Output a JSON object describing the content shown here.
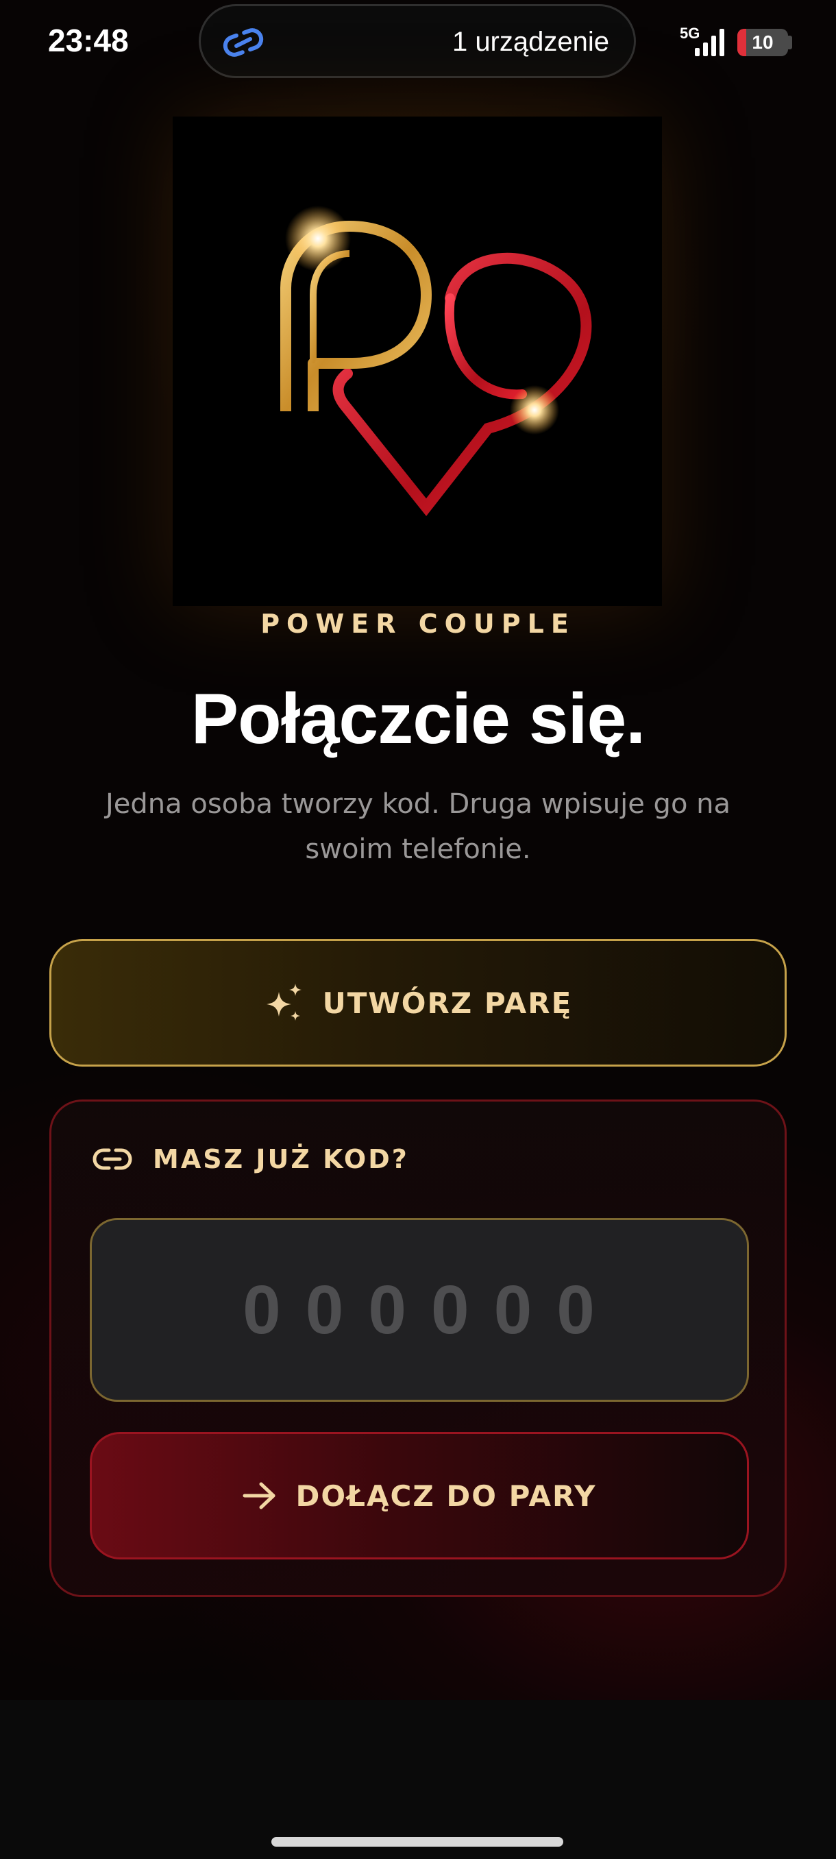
{
  "status_bar": {
    "time": "23:48",
    "island_text": "1 urządzenie",
    "network": "5G",
    "battery": "10",
    "battery_level_percent": 10
  },
  "brand": {
    "name": "POWER COUPLE"
  },
  "main": {
    "title": "Połączcie się.",
    "subtitle": "Jedna osoba tworzy kod. Druga wpisuje go na swoim telefonie."
  },
  "create_button": {
    "label": "UTWÓRZ PARĘ",
    "icon": "sparkles-icon"
  },
  "join_card": {
    "header_label": "MASZ JUŻ KOD?",
    "header_icon": "link-icon",
    "code_placeholder": "000000",
    "code_value": "",
    "join_label": "DOŁĄCZ DO PARY",
    "join_icon": "arrow-right-icon"
  },
  "colors": {
    "gold": "#f3d7a4",
    "gold_border": "#c6a24a",
    "red_border": "#9a1420",
    "background": "#070404"
  }
}
